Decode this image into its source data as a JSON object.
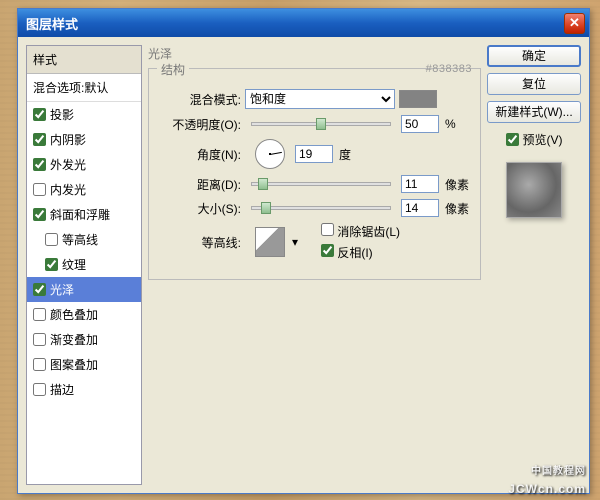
{
  "window": {
    "title": "图层样式"
  },
  "styles_panel": {
    "header": "样式",
    "blend_options": "混合选项:默认",
    "items": [
      {
        "label": "投影",
        "checked": true
      },
      {
        "label": "内阴影",
        "checked": true
      },
      {
        "label": "外发光",
        "checked": true
      },
      {
        "label": "内发光",
        "checked": false
      },
      {
        "label": "斜面和浮雕",
        "checked": true
      },
      {
        "label": "等高线",
        "checked": false,
        "indent": true
      },
      {
        "label": "纹理",
        "checked": true,
        "indent": true
      },
      {
        "label": "光泽",
        "checked": true,
        "selected": true
      },
      {
        "label": "颜色叠加",
        "checked": false
      },
      {
        "label": "渐变叠加",
        "checked": false
      },
      {
        "label": "图案叠加",
        "checked": false
      },
      {
        "label": "描边",
        "checked": false
      }
    ]
  },
  "main": {
    "title": "光泽",
    "fieldset": "结构",
    "hex": "#838383",
    "blend_mode_label": "混合模式:",
    "blend_mode_value": "饱和度",
    "swatch_color": "#838383",
    "opacity_label": "不透明度(O):",
    "opacity_value": "50",
    "opacity_unit": "%",
    "angle_label": "角度(N):",
    "angle_value": "19",
    "angle_unit": "度",
    "distance_label": "距离(D):",
    "distance_value": "11",
    "distance_unit": "像素",
    "size_label": "大小(S):",
    "size_value": "14",
    "size_unit": "像素",
    "contour_label": "等高线:",
    "antialias_label": "消除锯齿(L)",
    "antialias_checked": false,
    "invert_label": "反相(I)",
    "invert_checked": true
  },
  "buttons": {
    "ok": "确定",
    "cancel": "复位",
    "new_style": "新建样式(W)...",
    "preview": "预览(V)"
  },
  "watermark": {
    "top": "中国教程网",
    "bottom": "JCWcn.com"
  }
}
